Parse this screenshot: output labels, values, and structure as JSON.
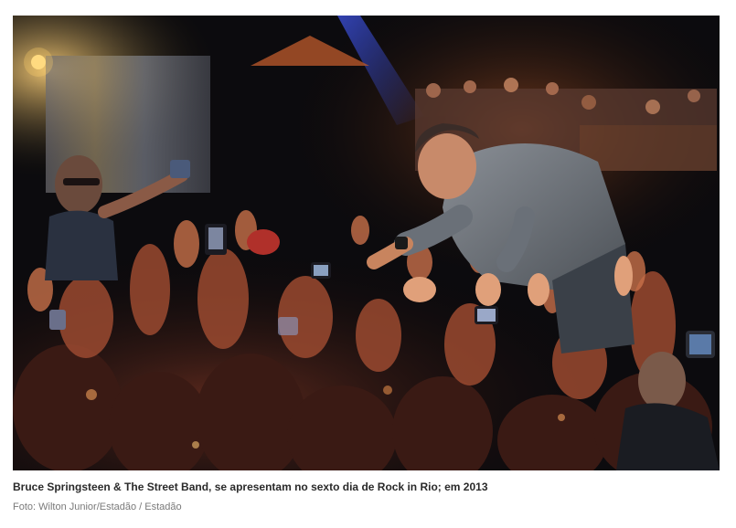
{
  "figure": {
    "caption": "Bruce Springsteen & The Street Band, se apresentam no sexto dia de Rock in Rio; em 2013",
    "credit": "Foto: Wilton Junior/Estadão / Estadão"
  },
  "photo": {
    "subject": "performer-reaching-into-crowd",
    "colors": {
      "background": "#0b0a0c",
      "stage_light": "#f2b35a",
      "crowd_skin": "#c77a52",
      "shirt": "#6f747b",
      "caption_text": "#2a2a2a",
      "credit_text": "#7a7a7a"
    }
  }
}
